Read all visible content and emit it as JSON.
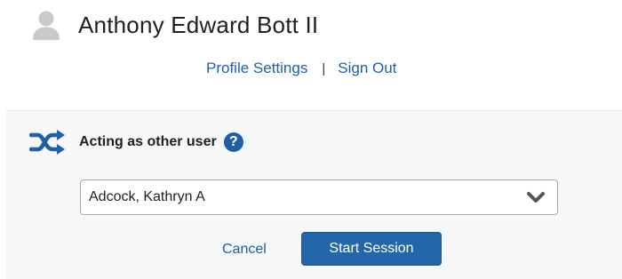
{
  "header": {
    "user_name": "Anthony Edward Bott II",
    "avatar_icon": "user-silhouette-icon"
  },
  "profile_links": {
    "settings_label": "Profile Settings",
    "separator": "|",
    "sign_out_label": "Sign Out"
  },
  "impersonation": {
    "icon": "shuffle-icon",
    "title": "Acting as other user",
    "help_icon": "question-mark-icon",
    "help_glyph": "?",
    "selected_user": "Adcock, Kathryn A",
    "dropdown_icon": "chevron-down-icon",
    "cancel_label": "Cancel",
    "start_label": "Start Session"
  },
  "colors": {
    "link": "#1f5fa5",
    "primary_button": "#2467a8",
    "panel_background": "#f6f7f8",
    "icon_gray": "#c8c9cb",
    "text": "#202122"
  }
}
